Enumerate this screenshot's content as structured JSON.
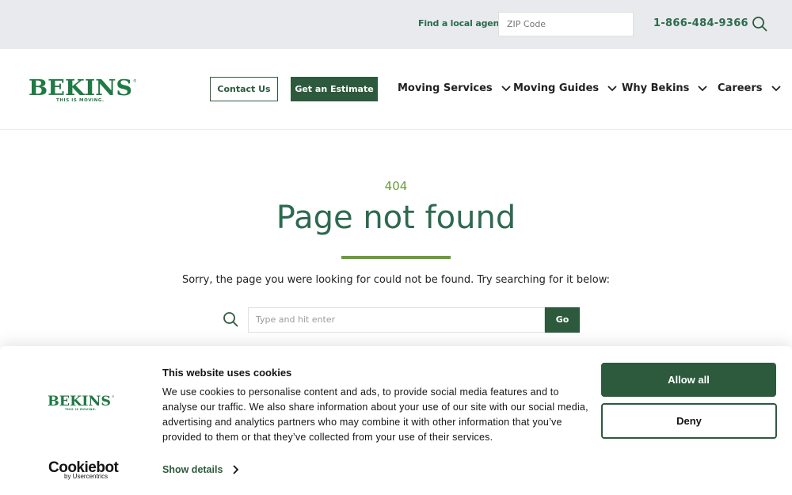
{
  "topbar": {
    "agent_label": "Find a local agent",
    "zip_placeholder": "ZIP Code",
    "phone": "1-866-484-9366"
  },
  "header": {
    "logo": {
      "wordmark": "BEKINS",
      "tagline": "THIS IS MOVING."
    },
    "contact_label": "Contact Us",
    "estimate_label": "Get an Estimate",
    "nav": [
      "Moving Services",
      "Moving Guides",
      "Why Bekins",
      "Careers"
    ]
  },
  "main": {
    "code": "404",
    "title": "Page not found",
    "message": "Sorry, the page you were looking for could not be found. Try searching for it below:",
    "search_placeholder": "Type and hit enter",
    "go_label": "Go"
  },
  "cookie": {
    "title": "This website uses cookies",
    "text": "We use cookies to personalise content and ads, to provide social media features and to analyse our traffic. We also share information about your use of our site with our social media, advertising and analytics partners who may combine it with other information that you’ve provided to them or that they’ve collected from your use of their services.",
    "show_details": "Show details",
    "allow_label": "Allow all",
    "deny_label": "Deny",
    "brand": "Cookiebot",
    "brand_sub": "by Usercentrics"
  },
  "colors": {
    "brand_green": "#2d5a3d",
    "accent_green": "#6a9c3a",
    "logo_green": "#1f7a44"
  }
}
